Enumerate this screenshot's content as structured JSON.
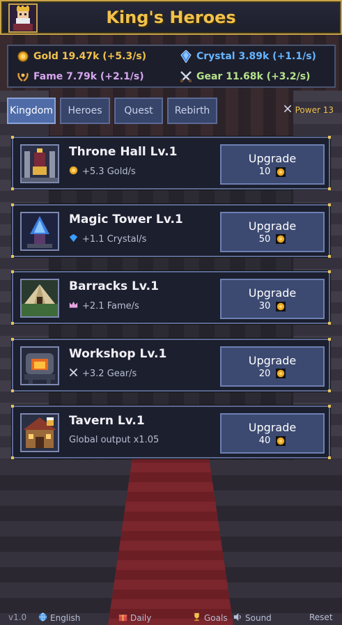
{
  "header": {
    "title": "King's Heroes"
  },
  "resources": {
    "gold": {
      "text": "Gold 19.47k (+5.3/s)",
      "icon": "gold-coin-icon",
      "color": "#f2c24e"
    },
    "crystal": {
      "text": "Crystal 3.89k (+1.1/s)",
      "icon": "crystal-icon",
      "color": "#66b6ff"
    },
    "fame": {
      "text": "Fame 7.79k (+2.1/s)",
      "icon": "laurel-icon",
      "color": "#d6a6ee"
    },
    "gear": {
      "text": "Gear 11.68k (+3.2/s)",
      "icon": "crossed-swords-icon",
      "color": "#b7e28c"
    }
  },
  "tabs": [
    {
      "label": "Kingdom",
      "active": true
    },
    {
      "label": "Heroes",
      "active": false
    },
    {
      "label": "Quest",
      "active": false
    },
    {
      "label": "Rebirth",
      "active": false
    }
  ],
  "power": {
    "label": "Power 13",
    "icon": "crossed-swords-icon"
  },
  "buildings": [
    {
      "name": "Throne Hall  Lv.1",
      "production": "+5.3 Gold/s",
      "prod_icon": "gold-coin-icon",
      "upgrade_label": "Upgrade",
      "cost": "10"
    },
    {
      "name": "Magic Tower  Lv.1",
      "production": "+1.1 Crystal/s",
      "prod_icon": "crystal-icon",
      "upgrade_label": "Upgrade",
      "cost": "50"
    },
    {
      "name": "Barracks  Lv.1",
      "production": "+2.1 Fame/s",
      "prod_icon": "crown-icon",
      "upgrade_label": "Upgrade",
      "cost": "30"
    },
    {
      "name": "Workshop  Lv.1",
      "production": "+3.2 Gear/s",
      "prod_icon": "crossed-swords-icon",
      "upgrade_label": "Upgrade",
      "cost": "20"
    },
    {
      "name": "Tavern  Lv.1",
      "production": "Global output x1.05",
      "prod_icon": "",
      "upgrade_label": "Upgrade",
      "cost": "40"
    }
  ],
  "footer": {
    "version": "v1.0",
    "language": "English",
    "daily": "Daily",
    "goals": "Goals",
    "sound": "Sound",
    "reset": "Reset"
  }
}
